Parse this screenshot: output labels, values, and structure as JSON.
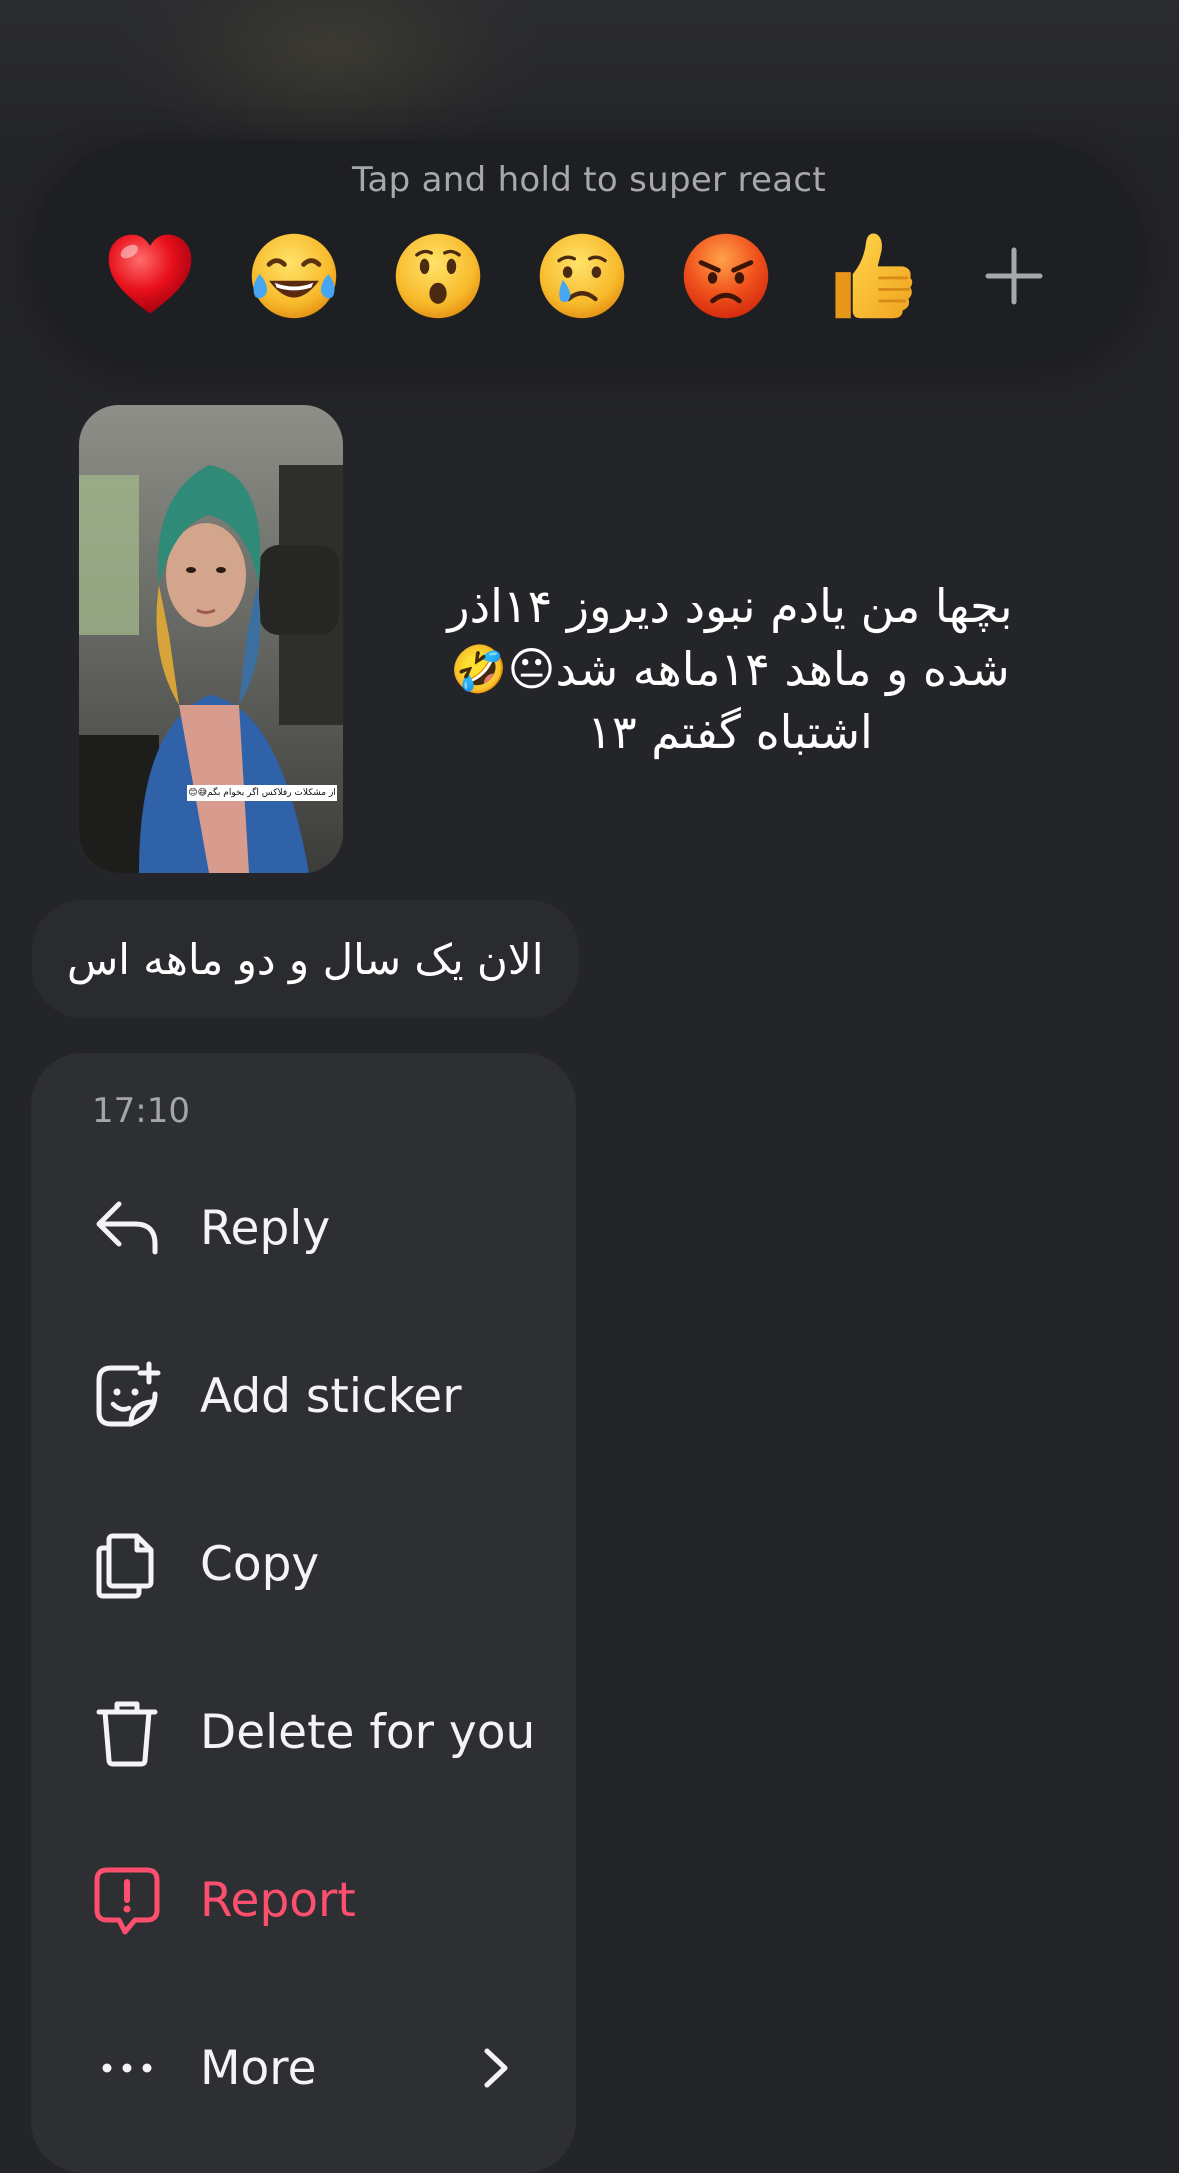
{
  "reaction_bar": {
    "hint": "Tap and hold to super react",
    "reactions": [
      {
        "icon": "red-heart-emoji"
      },
      {
        "icon": "tears-of-joy-emoji"
      },
      {
        "icon": "surprised-face-emoji"
      },
      {
        "icon": "crying-face-emoji"
      },
      {
        "icon": "angry-face-emoji"
      },
      {
        "icon": "thumbs-up-emoji"
      },
      {
        "icon": "plus-icon"
      }
    ]
  },
  "shared_post": {
    "caption_line1": "بچها من یادم نبود دیروز ۱۴اذر",
    "caption_line2": "شده و ماهد ۱۴ماهه شد😐🤣",
    "caption_line3": "اشتباه گفتم ۱۳",
    "overlay_text": "از مشکلات رفلاکس اگر بخوام بگم😅😊"
  },
  "message": {
    "text": "الان یک سال و دو ماهه اس"
  },
  "menu": {
    "time": "17:10",
    "items": [
      {
        "label": "Reply",
        "icon": "reply-arrow-icon"
      },
      {
        "label": "Add sticker",
        "icon": "sticker-icon"
      },
      {
        "label": "Copy",
        "icon": "copy-icon"
      },
      {
        "label": "Delete for you",
        "icon": "trash-icon"
      },
      {
        "label": "Report",
        "icon": "report-icon"
      },
      {
        "label": "More",
        "icon": "more-dots-icon"
      }
    ]
  },
  "colors": {
    "background": "#242528",
    "menu_background": "#2e2f33",
    "danger": "#ff4f6e"
  }
}
